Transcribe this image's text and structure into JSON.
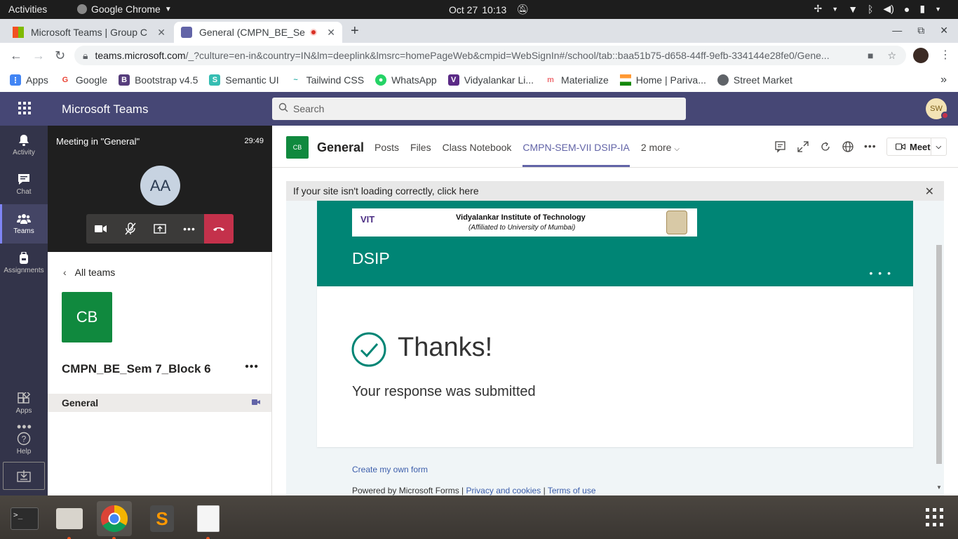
{
  "system": {
    "activities": "Activities",
    "app_menu": "Google Chrome",
    "date": "Oct 27",
    "time": "10:13"
  },
  "browser": {
    "tabs": [
      {
        "title": "Microsoft Teams | Group C",
        "active": false
      },
      {
        "title": "General (CMPN_BE_Se",
        "active": true
      }
    ],
    "url_host": "teams.microsoft.com",
    "url_path": "/_?culture=en-in&country=IN&lm=deeplink&lmsrc=homePageWeb&cmpid=WebSignIn#/school/tab::baa51b75-d658-44ff-9efb-334144e28fe0/Gene...",
    "bookmarks": [
      {
        "label": "Apps",
        "icon": "apps-grid-icon",
        "color": "#4285f4"
      },
      {
        "label": "Google",
        "icon": "google-icon",
        "color": "#ea4335"
      },
      {
        "label": "Bootstrap v4.5",
        "icon": "bootstrap-icon",
        "color": "#563d7c"
      },
      {
        "label": "Semantic UI",
        "icon": "semantic-icon",
        "color": "#35bdb2"
      },
      {
        "label": "Tailwind CSS",
        "icon": "tailwind-icon",
        "color": "#38b2ac"
      },
      {
        "label": "WhatsApp",
        "icon": "whatsapp-icon",
        "color": "#25d366"
      },
      {
        "label": "Vidyalankar Li...",
        "icon": "vidyalankar-icon",
        "color": "#5b2a86"
      },
      {
        "label": "Materialize",
        "icon": "materialize-icon",
        "color": "#ee6e73"
      },
      {
        "label": "Home | Pariva...",
        "icon": "india-flag-icon",
        "color": "#ff9933"
      },
      {
        "label": "Street Market",
        "icon": "globe-icon",
        "color": "#5f6368"
      }
    ]
  },
  "teams": {
    "app_title": "Microsoft Teams",
    "search_placeholder": "Search",
    "user_initials": "SW",
    "rail": [
      {
        "label": "Activity",
        "icon": "bell-icon"
      },
      {
        "label": "Chat",
        "icon": "chat-icon"
      },
      {
        "label": "Teams",
        "icon": "teams-icon",
        "active": true
      },
      {
        "label": "Assignments",
        "icon": "backpack-icon"
      },
      {
        "label": "Apps",
        "icon": "apps-icon"
      },
      {
        "label": "Help",
        "icon": "help-icon"
      }
    ],
    "meeting": {
      "title": "Meeting in \"General\"",
      "timer": "29:49",
      "participant_initials": "AA"
    },
    "team_pane": {
      "all_teams": "All teams",
      "team_initials": "CB",
      "team_name": "CMPN_BE_Sem 7_Block 6",
      "channel": "General"
    },
    "channel_header": {
      "initials": "CB",
      "name": "General",
      "tabs": [
        "Posts",
        "Files",
        "Class Notebook",
        "CMPN-SEM-VII DSIP-IA",
        "2 more"
      ],
      "active_tab": "CMPN-SEM-VII DSIP-IA",
      "meet_label": "Meet"
    },
    "site_notice": "If your site isn't loading correctly, click here"
  },
  "form": {
    "logo_vit": "VIT",
    "logo_institute": "Vidyalankar Institute of Technology",
    "logo_affiliation": "(Affiliated to University of Mumbai)",
    "title": "DSIP",
    "thanks": "Thanks!",
    "message": "Your response was submitted",
    "create_link": "Create my own form",
    "powered_by": "Powered by Microsoft Forms |",
    "privacy": "Privacy and cookies",
    "separator": "|",
    "terms": "Terms of use",
    "accent_color": "#008575"
  }
}
